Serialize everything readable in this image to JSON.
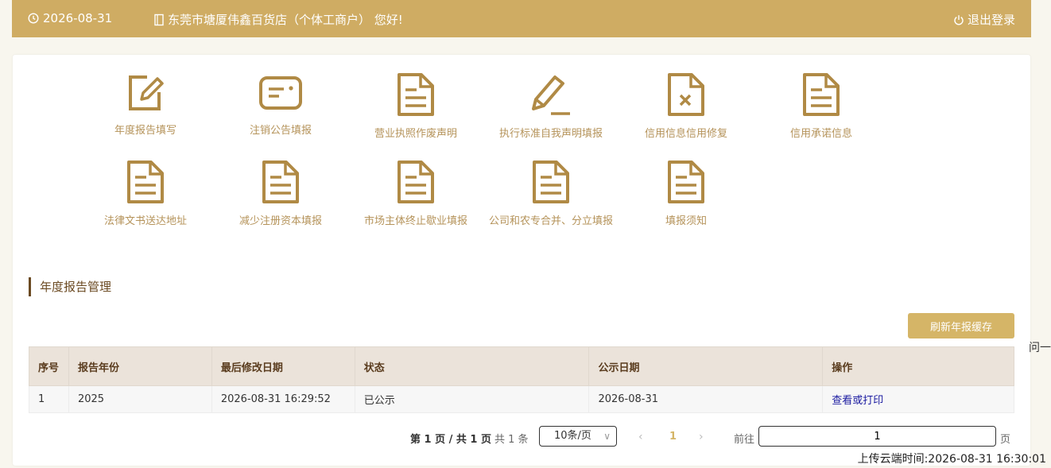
{
  "header": {
    "date": "2026-08-31",
    "shop_greeting": "东莞市塘厦伟鑫百货店（个体工商户） 您好!",
    "logout_label": "退出登录"
  },
  "accent_color": "#cfac63",
  "tiles": [
    {
      "label": "年度报告填写",
      "icon": "edit-icon"
    },
    {
      "label": "注销公告填报",
      "icon": "card-icon"
    },
    {
      "label": "营业执照作废声明",
      "icon": "document-icon"
    },
    {
      "label": "执行标准自我声明填报",
      "icon": "pencil-icon"
    },
    {
      "label": "信用信息信用修复",
      "icon": "document-x-icon"
    },
    {
      "label": "信用承诺信息",
      "icon": "document-icon"
    },
    {
      "label": "法律文书送达地址",
      "icon": "document-icon"
    },
    {
      "label": "减少注册资本填报",
      "icon": "document-icon"
    },
    {
      "label": "市场主体终止歇业填报",
      "icon": "document-icon"
    },
    {
      "label": "公司和农专合并、分立填报",
      "icon": "document-icon"
    },
    {
      "label": "填报须知",
      "icon": "document-icon"
    }
  ],
  "section": {
    "title": "年度报告管理",
    "refresh_label": "刷新年报缓存"
  },
  "table": {
    "headers": [
      "序号",
      "报告年份",
      "最后修改日期",
      "状态",
      "公示日期",
      "操作"
    ],
    "rows": [
      {
        "index": "1",
        "year": "2025",
        "modified": "2026-08-31 16:29:52",
        "status": "已公示",
        "publish_date": "2026-08-31",
        "action": "查看或打印"
      }
    ]
  },
  "pagination": {
    "info": "第 1 页 / 共 1 页",
    "total": "共 1 条",
    "page_size": "10条/页",
    "current": "1",
    "goto_label": "前往",
    "goto_value": "1",
    "goto_unit": "页"
  },
  "side_text": "问一",
  "upload_time": "上传云端时间:2026-08-31 16:30:01"
}
